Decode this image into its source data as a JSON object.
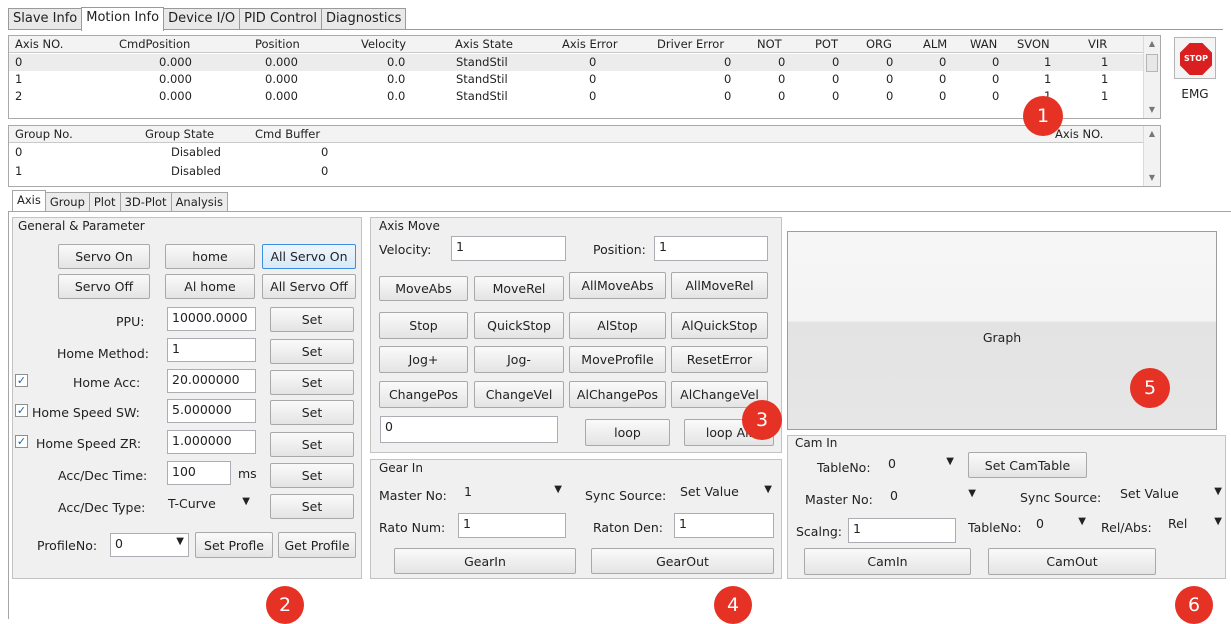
{
  "top_tabs": [
    "Slave Info",
    "Motion Info",
    "Device I/O",
    "PID Control",
    "Diagnostics"
  ],
  "axis_table": {
    "headers": [
      "Axis NO.",
      "CmdPosition",
      "Position",
      "Velocity",
      "Axis State",
      "Axis Error",
      "Driver Error",
      "NOT",
      "POT",
      "ORG",
      "ALM",
      "WAN",
      "SVON",
      "VIR"
    ],
    "rows": [
      [
        "0",
        "0.000",
        "0.000",
        "0.0",
        "StandStil",
        "0",
        "0",
        "0",
        "0",
        "0",
        "0",
        "0",
        "1",
        "1"
      ],
      [
        "1",
        "0.000",
        "0.000",
        "0.0",
        "StandStil",
        "0",
        "0",
        "0",
        "0",
        "0",
        "0",
        "0",
        "1",
        "1"
      ],
      [
        "2",
        "0.000",
        "0.000",
        "0.0",
        "StandStil",
        "0",
        "0",
        "0",
        "0",
        "0",
        "0",
        "0",
        "1",
        "1"
      ]
    ]
  },
  "group_table": {
    "headers": [
      "Group No.",
      "Group State",
      "Cmd Buffer",
      "Axis NO."
    ],
    "rows": [
      [
        "0",
        "Disabled",
        "0"
      ],
      [
        "1",
        "Disabled",
        "0"
      ]
    ]
  },
  "emergency": {
    "icon_text": "STOP",
    "label": "EMG"
  },
  "bottom_tabs": [
    "Axis",
    "Group",
    "Plot",
    "3D-Plot",
    "Analysis"
  ],
  "general": {
    "title": "General & Parameter",
    "servo_on": "Servo On",
    "home": "home",
    "all_servo_on": "All Servo On",
    "servo_off": "Servo Off",
    "all_home": "Al home",
    "all_servo_off": "All Servo Off",
    "ppu_label": "PPU:",
    "ppu_value": "10000.0000",
    "home_method_label": "Home Method:",
    "home_method_value": "1",
    "home_acc_label": "Home Acc:",
    "home_acc_value": "20.000000",
    "home_acc_checked": true,
    "home_speed_sw_label": "Home Speed SW:",
    "home_speed_sw_value": "5.000000",
    "home_speed_sw_checked": true,
    "home_speed_zr_label": "Home Speed ZR:",
    "home_speed_zr_value": "1.000000",
    "home_speed_zr_checked": true,
    "acc_dec_time_label": "Acc/Dec Time:",
    "acc_dec_time_value": "100",
    "acc_dec_time_unit": "ms",
    "acc_dec_type_label": "Acc/Dec Type:",
    "acc_dec_type_value": "T-Curve",
    "set_label": "Set",
    "profile_no_label": "ProfileNo:",
    "profile_no_value": "0",
    "set_profile": "Set Profle",
    "get_profile": "Get Profile"
  },
  "axis_move": {
    "title": "Axis Move",
    "velocity_label": "Velocity:",
    "velocity_value": "1",
    "position_label": "Position:",
    "position_value": "1",
    "buttons": [
      "MoveAbs",
      "MoveRel",
      "AllMoveAbs",
      "AllMoveRel",
      "Stop",
      "QuickStop",
      "AlStop",
      "AlQuickStop",
      "Jog+",
      "Jog-",
      "MoveProfile",
      "ResetError",
      "ChangePos",
      "ChangeVel",
      "AlChangePos",
      "AlChangeVel"
    ],
    "loop_value": "0",
    "loop_label": "loop",
    "loop_all_label": "loop All"
  },
  "gear_in": {
    "title": "Gear In",
    "master_no_label": "Master No:",
    "master_no_value": "1",
    "sync_source_label": "Sync Source:",
    "sync_source_value": "Set Value",
    "ratio_num_label": "Rato Num:",
    "ratio_num_value": "1",
    "ratio_den_label": "Raton Den:",
    "ratio_den_value": "1",
    "gear_in_button": "GearIn",
    "gear_out_button": "GearOut"
  },
  "graph": {
    "label": "Graph"
  },
  "cam_in": {
    "title": "Cam In",
    "table_no_label": "TableNo:",
    "table_no_value": "0",
    "set_cam_table": "Set CamTable",
    "master_no_label": "Master No:",
    "master_no_value": "0",
    "sync_source_label": "Sync Source:",
    "sync_source_value": "Set Value",
    "scaling_label": "Scalng:",
    "scaling_value": "1",
    "table_no2_label": "TableNo:",
    "table_no2_value": "0",
    "rel_abs_label": "Rel/Abs:",
    "rel_abs_value": "Rel",
    "cam_in_button": "CamIn",
    "cam_out_button": "CamOut"
  },
  "badges": [
    "1",
    "2",
    "3",
    "4",
    "5",
    "6"
  ],
  "colors": {
    "badge": "#e53224",
    "selected_button_border": "#3d8ee0",
    "stop_icon": "#d91f1f"
  }
}
